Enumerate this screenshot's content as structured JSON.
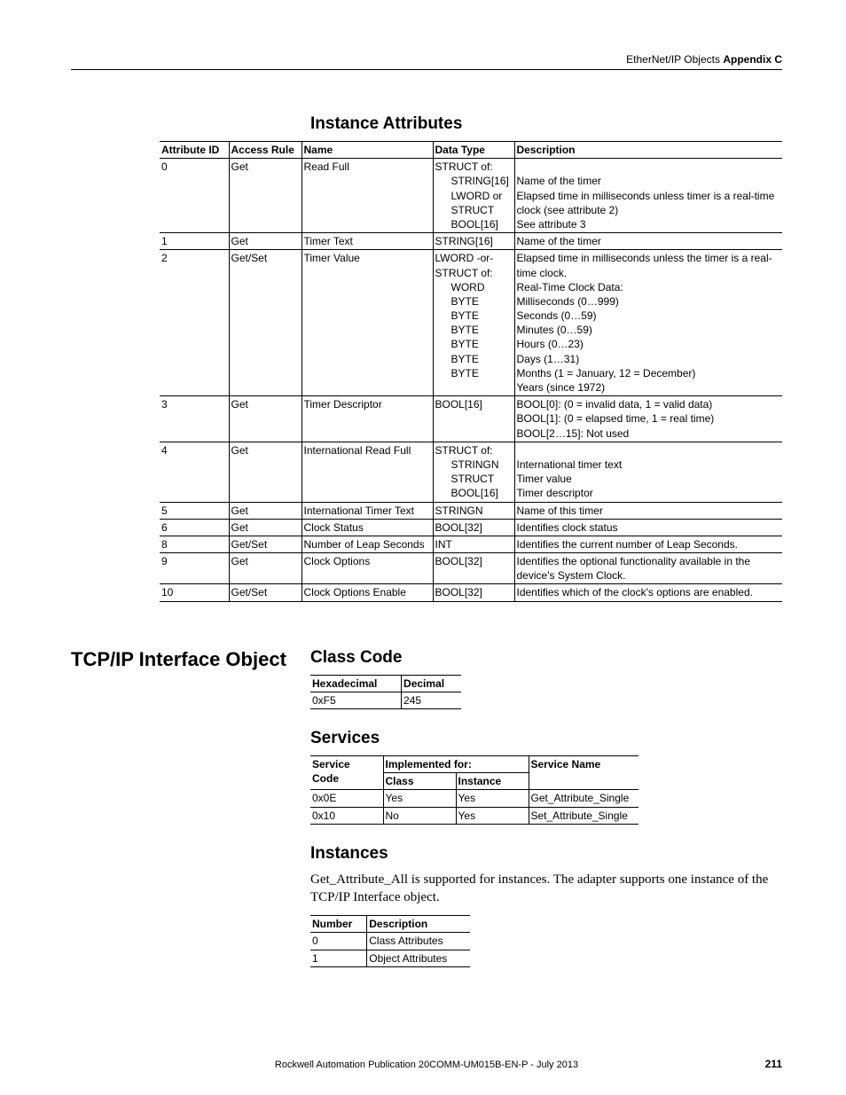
{
  "header": {
    "section": "EtherNet/IP Objects",
    "appendix": "Appendix C"
  },
  "inst_attr": {
    "title": "Instance Attributes",
    "cols": [
      "Attribute ID",
      "Access Rule",
      "Name",
      "Data Type",
      "Description"
    ],
    "rows": [
      {
        "id": "0",
        "rule": "Get",
        "name": "Read Full",
        "dt": [
          "STRUCT of:",
          "STRING[16]",
          "LWORD or STRUCT",
          "BOOL[16]"
        ],
        "dt_indent": [
          false,
          true,
          true,
          true
        ],
        "desc": [
          "",
          "Name of the timer",
          "Elapsed time in milliseconds unless timer is a real-time clock (see attribute 2)",
          "See attribute 3"
        ]
      },
      {
        "id": "1",
        "rule": "Get",
        "name": "Timer Text",
        "dt": [
          "STRING[16]"
        ],
        "dt_indent": [
          false
        ],
        "desc": [
          "Name of the timer"
        ]
      },
      {
        "id": "2",
        "rule": "Get/Set",
        "name": "Timer Value",
        "dt": [
          "LWORD -or-",
          "STRUCT of:",
          "WORD",
          "BYTE",
          "BYTE",
          "BYTE",
          "BYTE",
          "BYTE",
          "BYTE"
        ],
        "dt_indent": [
          false,
          false,
          true,
          true,
          true,
          true,
          true,
          true,
          true
        ],
        "desc": [
          "Elapsed time in milliseconds unless the timer is a real-time clock.",
          "Real-Time Clock Data:",
          "Milliseconds (0…999)",
          "Seconds (0…59)",
          "Minutes (0…59)",
          "Hours (0…23)",
          "Days (1…31)",
          "Months (1 = January, 12 = December)",
          "Years (since 1972)"
        ]
      },
      {
        "id": "3",
        "rule": "Get",
        "name": "Timer Descriptor",
        "dt": [
          "BOOL[16]"
        ],
        "dt_indent": [
          false
        ],
        "desc": [
          "BOOL[0]: (0 = invalid data, 1 = valid data)\nBOOL[1]: (0 = elapsed time, 1 = real time)\nBOOL[2…15]: Not used"
        ]
      },
      {
        "id": "4",
        "rule": "Get",
        "name": "International Read Full",
        "dt": [
          "STRUCT of:",
          "STRINGN",
          "STRUCT",
          "BOOL[16]"
        ],
        "dt_indent": [
          false,
          true,
          true,
          true
        ],
        "desc": [
          "",
          "International timer text",
          "Timer value",
          "Timer descriptor"
        ]
      },
      {
        "id": "5",
        "rule": "Get",
        "name": "International Timer Text",
        "dt": [
          "STRINGN"
        ],
        "dt_indent": [
          false
        ],
        "desc": [
          "Name of this timer"
        ]
      },
      {
        "id": "6",
        "rule": "Get",
        "name": "Clock Status",
        "dt": [
          "BOOL[32]"
        ],
        "dt_indent": [
          false
        ],
        "desc": [
          "Identifies clock status"
        ]
      },
      {
        "id": "8",
        "rule": "Get/Set",
        "name": "Number of Leap Seconds",
        "dt": [
          "INT"
        ],
        "dt_indent": [
          false
        ],
        "desc": [
          "Identifies the current number of Leap Seconds."
        ]
      },
      {
        "id": "9",
        "rule": "Get",
        "name": "Clock Options",
        "dt": [
          "BOOL[32]"
        ],
        "dt_indent": [
          false
        ],
        "desc": [
          "Identifies the optional functionality available in the device's System Clock."
        ]
      },
      {
        "id": "10",
        "rule": "Get/Set",
        "name": "Clock Options Enable",
        "dt": [
          "BOOL[32]"
        ],
        "dt_indent": [
          false
        ],
        "desc": [
          "Identifies which of the clock's options are enabled."
        ]
      }
    ]
  },
  "tcpip": {
    "left_title": "TCP/IP Interface Object",
    "class_code": {
      "title": "Class Code",
      "cols": [
        "Hexadecimal",
        "Decimal"
      ],
      "row": [
        "0xF5",
        "245"
      ]
    },
    "services": {
      "title": "Services",
      "h1": "Service Code",
      "h2": "Implemented for:",
      "h3": "Service Name",
      "sub1": "Class",
      "sub2": "Instance",
      "rows": [
        [
          "0x0E",
          "Yes",
          "Yes",
          "Get_Attribute_Single"
        ],
        [
          "0x10",
          "No",
          "Yes",
          "Set_Attribute_Single"
        ]
      ]
    },
    "instances": {
      "title": "Instances",
      "text": "Get_Attribute_All is supported for instances. The adapter supports one instance of the TCP/IP Interface object.",
      "cols": [
        "Number",
        "Description"
      ],
      "rows": [
        [
          "0",
          "Class Attributes"
        ],
        [
          "1",
          "Object Attributes"
        ]
      ]
    }
  },
  "footer": {
    "pub": "Rockwell Automation Publication  20COMM-UM015B-EN-P - July 2013",
    "page": "211"
  }
}
